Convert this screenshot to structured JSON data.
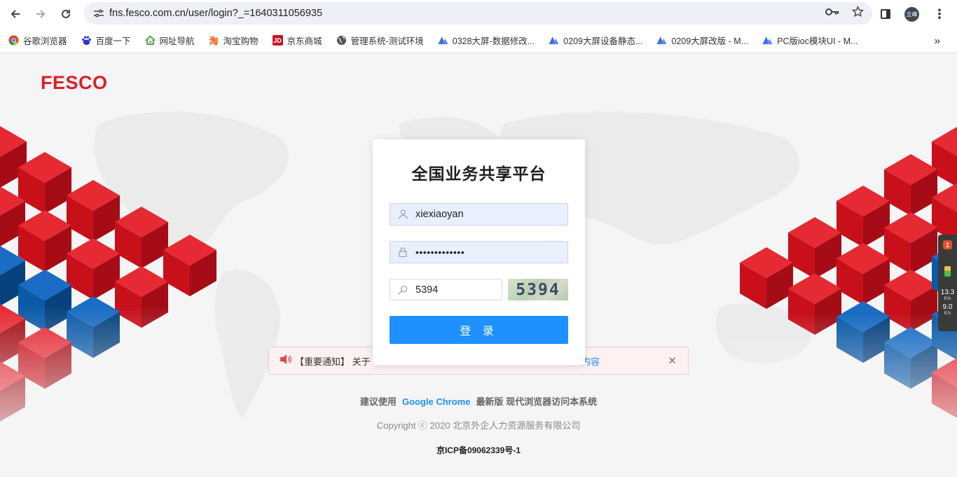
{
  "browser": {
    "url": "fns.fesco.com.cn/user/login?_=1640311056935",
    "profile_initials": "立峰",
    "bookmarks": [
      {
        "label": "谷歌浏览器",
        "icon": "chrome-icon"
      },
      {
        "label": "百度一下",
        "icon": "baidu-icon"
      },
      {
        "label": "网址导航",
        "icon": "home-icon"
      },
      {
        "label": "淘宝购物",
        "icon": "taobao-icon"
      },
      {
        "label": "京东商城",
        "icon": "jd-icon"
      },
      {
        "label": "管理系统-测试环境",
        "icon": "globe-icon"
      },
      {
        "label": "0328大屏-数据修改...",
        "icon": "lanhu-icon"
      },
      {
        "label": "0209大屏设备静态...",
        "icon": "lanhu-icon"
      },
      {
        "label": "0209大屏改版 - M...",
        "icon": "lanhu-icon"
      },
      {
        "label": "PC版ioc模块UI - M...",
        "icon": "lanhu-icon"
      }
    ]
  },
  "page": {
    "logo": "FESCO",
    "login": {
      "title": "全国业务共享平台",
      "username": "xiexiaoyan",
      "password_mask": "•••••••••••••",
      "captcha_value": "5394",
      "captcha_image_text": "5394",
      "submit_label": "登 录"
    },
    "notice": {
      "prefix": "【重要通知】 关于",
      "link": "内容"
    },
    "recommend": {
      "before": "建议使用",
      "browser": "Google Chrome",
      "after": "最新版  现代浏览器访问本系统"
    },
    "copyright": "Copyright ⓒ 2020 北京外企人力资源服务有限公司",
    "icp": "京ICP备09062339号-1"
  },
  "speed_widget": {
    "badge": "1",
    "up_value": "13.3",
    "up_unit": "K/s",
    "down_value": "9.0",
    "down_unit": "K/s"
  },
  "colors": {
    "brand_red": "#e11d27",
    "primary_blue": "#1e90ff",
    "cube_red": "#d8141e",
    "cube_blue": "#0b5aa8"
  }
}
